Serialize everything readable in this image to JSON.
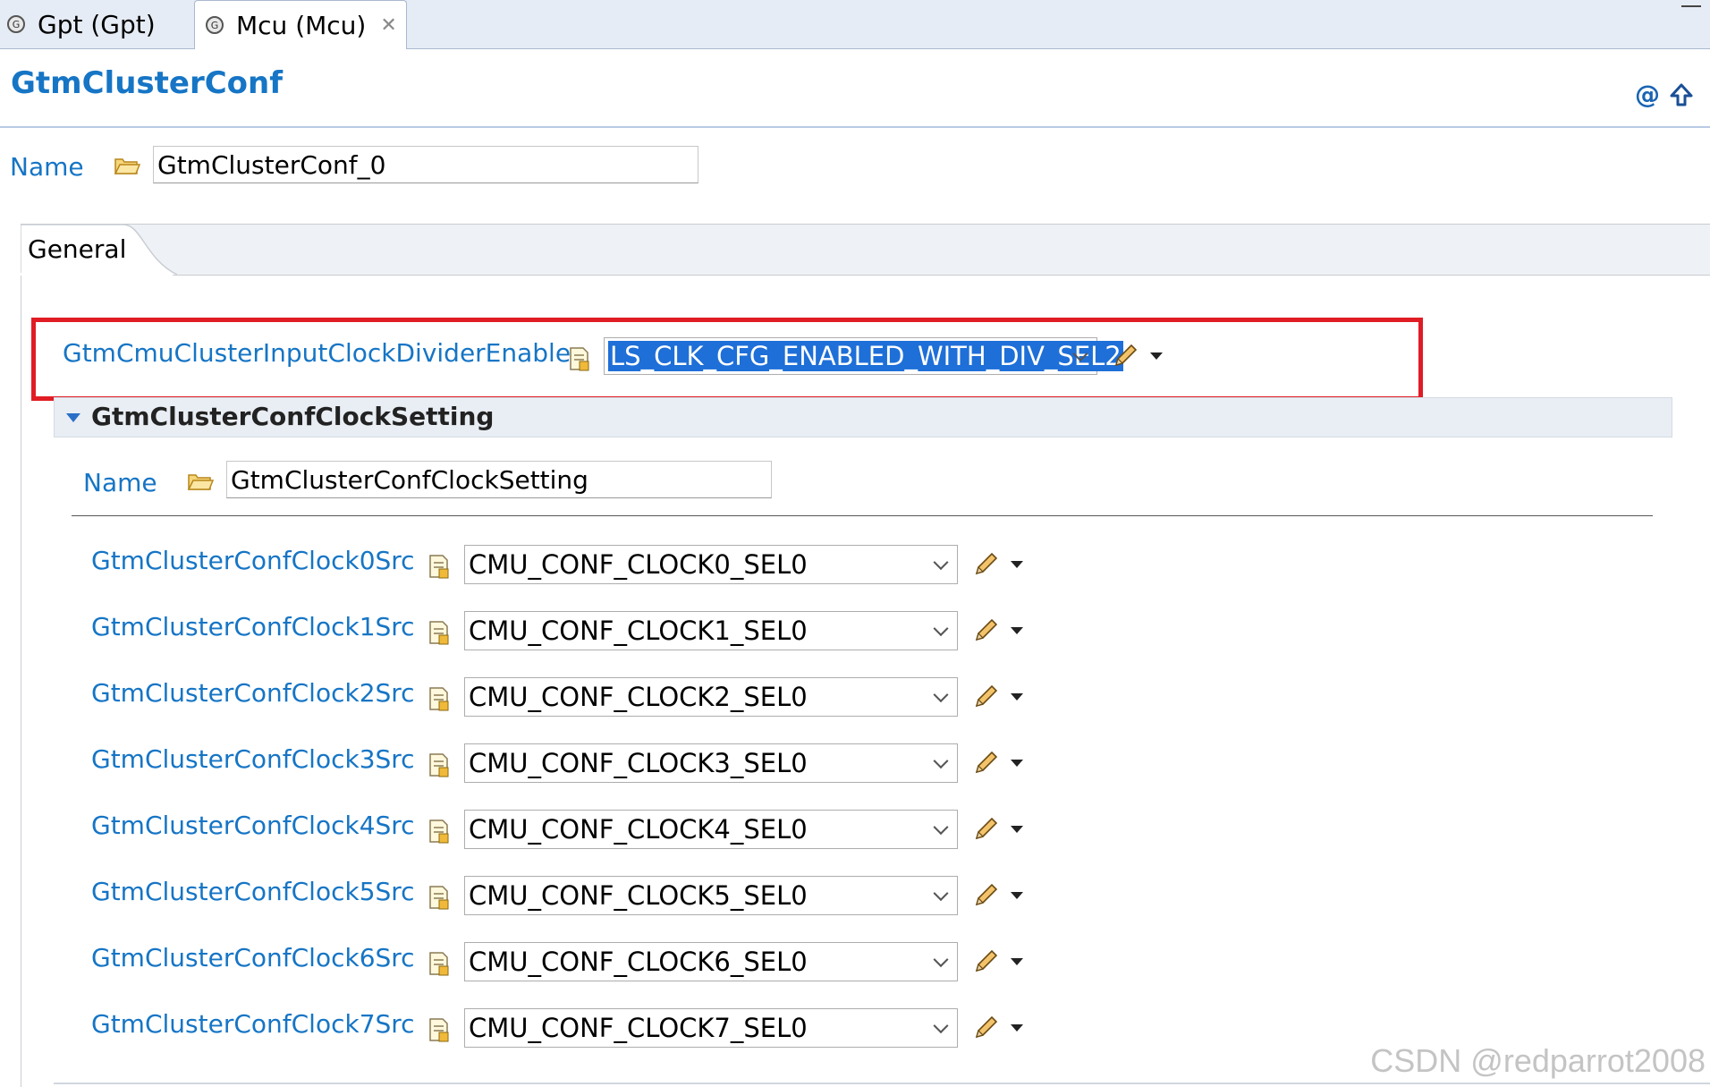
{
  "tabs": [
    {
      "label": "Gpt (Gpt)",
      "active": false
    },
    {
      "label": "Mcu (Mcu)",
      "active": true
    }
  ],
  "header": {
    "title": "GtmClusterConf",
    "icons": [
      "at-icon",
      "up-arrow-icon"
    ]
  },
  "name_field": {
    "label": "Name",
    "value": "GtmClusterConf_0"
  },
  "general_tab": {
    "label": "General"
  },
  "divider_enable": {
    "label": "GtmCmuClusterInputClockDividerEnable",
    "value": "LS_CLK_CFG_ENABLED_WITH_DIV_SEL2"
  },
  "clock_setting": {
    "title": "GtmClusterConfClockSetting",
    "name_label": "Name",
    "name_value": "GtmClusterConfClockSetting",
    "rows": [
      {
        "label": "GtmClusterConfClock0Src",
        "value": "CMU_CONF_CLOCK0_SEL0"
      },
      {
        "label": "GtmClusterConfClock1Src",
        "value": "CMU_CONF_CLOCK1_SEL0"
      },
      {
        "label": "GtmClusterConfClock2Src",
        "value": "CMU_CONF_CLOCK2_SEL0"
      },
      {
        "label": "GtmClusterConfClock3Src",
        "value": "CMU_CONF_CLOCK3_SEL0"
      },
      {
        "label": "GtmClusterConfClock4Src",
        "value": "CMU_CONF_CLOCK4_SEL0"
      },
      {
        "label": "GtmClusterConfClock5Src",
        "value": "CMU_CONF_CLOCK5_SEL0"
      },
      {
        "label": "GtmClusterConfClock6Src",
        "value": "CMU_CONF_CLOCK6_SEL0"
      },
      {
        "label": "GtmClusterConfClock7Src",
        "value": "CMU_CONF_CLOCK7_SEL0"
      }
    ]
  },
  "watermark": "CSDN @redparrot2008",
  "colors": {
    "link": "#1675c5",
    "highlight_border": "#e01c24",
    "selection": "#1e6fd8"
  }
}
